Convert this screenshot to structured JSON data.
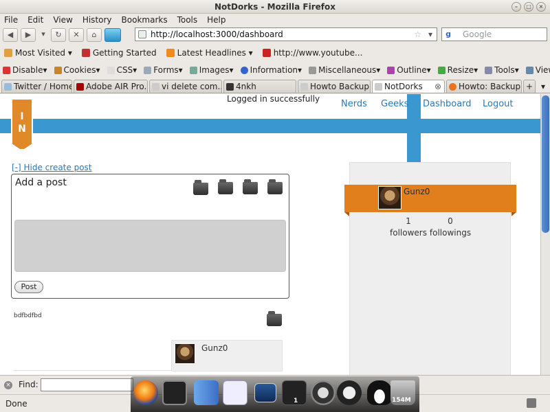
{
  "window": {
    "title": "NotDorks - Mozilla Firefox"
  },
  "menu": [
    "File",
    "Edit",
    "View",
    "History",
    "Bookmarks",
    "Tools",
    "Help"
  ],
  "nav": {
    "url": "http://localhost:3000/dashboard",
    "search_placeholder": "Google"
  },
  "bookmarks": [
    {
      "label": "Most Visited ▾",
      "color": "#e0a040"
    },
    {
      "label": "Getting Started",
      "color": "#c23030"
    },
    {
      "label": "Latest Headlines ▾",
      "color": "#f08a1c"
    },
    {
      "label": "http://www.youtube...",
      "color": "#cc2222"
    }
  ],
  "devbar": [
    "Disable▾",
    "Cookies▾",
    "CSS▾",
    "Forms▾",
    "Images▾",
    "Information▾",
    "Miscellaneous▾",
    "Outline▾",
    "Resize▾",
    "Tools▾",
    "View S"
  ],
  "tabs": [
    {
      "label": "Twitter / Home",
      "color": "#9bd",
      "active": false
    },
    {
      "label": "Adobe AIR Pro...",
      "color": "#a00",
      "active": false
    },
    {
      "label": "vi delete com...",
      "color": "#ccc",
      "active": false
    },
    {
      "label": "4nkh",
      "color": "#333",
      "active": false
    },
    {
      "label": "Howto Backup ...",
      "color": "#ccc",
      "active": false
    },
    {
      "label": "NotDorks",
      "color": "#ccc",
      "active": true
    },
    {
      "label": "Howto: Backup...",
      "color": "#e8731c",
      "active": false
    }
  ],
  "page": {
    "logo_text": "I\nN",
    "flash": "Logged in successfully",
    "nav_links": [
      "Nerds",
      "Geeks",
      "Dashboard",
      "Logout"
    ],
    "hide_post_link": "[-] Hide create post",
    "add_post_title": "Add a post",
    "post_button": "Post",
    "feed_text": "bdfbdfbd",
    "feed_user": "Gunz0",
    "sidebar": {
      "username": "Gunz0",
      "followers_count": "1",
      "followers_label": "followers",
      "followings_count": "0",
      "followings_label": "followings"
    }
  },
  "findbar": {
    "label": "Find:"
  },
  "status": {
    "text": "Done"
  },
  "dock": {
    "memory_label": "154M",
    "badge": "1"
  }
}
